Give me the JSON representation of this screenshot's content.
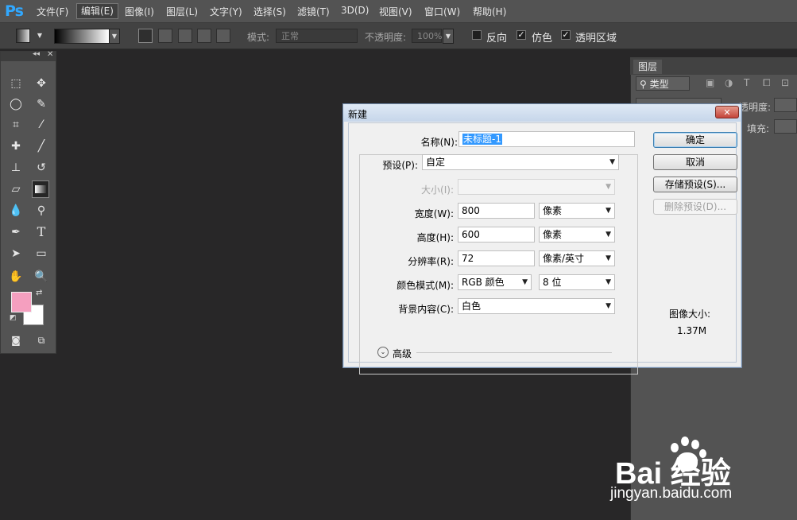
{
  "app": {
    "logo_text": "Ps"
  },
  "menubar": {
    "items": [
      "文件(F)",
      "编辑(E)",
      "图像(I)",
      "图层(L)",
      "文字(Y)",
      "选择(S)",
      "滤镜(T)",
      "3D(D)",
      "视图(V)",
      "窗口(W)",
      "帮助(H)"
    ],
    "active_index": 1
  },
  "options": {
    "mode_label": "模式:",
    "mode_value": "正常",
    "opacity_label": "不透明度:",
    "opacity_value": "100%",
    "reverse_label": "反向",
    "reverse_checked": false,
    "dither_label": "仿色",
    "dither_checked": true,
    "transparency_label": "透明区域",
    "transparency_checked": true
  },
  "tools": {
    "foreground_color": "#f59fbf",
    "background_color": "#ffffff",
    "selected": "gradient-tool"
  },
  "layers_panel": {
    "tab_label": "图层",
    "filter_label": "类型",
    "opacity_label": "透明度:",
    "fill_label": "填充:"
  },
  "dialog": {
    "title": "新建",
    "close_symbol": "✕",
    "name_label": "名称(N):",
    "name_value": "未标题-1",
    "preset_label": "预设(P):",
    "preset_value": "自定",
    "size_label": "大小(I):",
    "size_value": "",
    "width_label": "宽度(W):",
    "width_value": "800",
    "width_unit": "像素",
    "height_label": "高度(H):",
    "height_value": "600",
    "height_unit": "像素",
    "resolution_label": "分辨率(R):",
    "resolution_value": "72",
    "resolution_unit": "像素/英寸",
    "colormode_label": "颜色模式(M):",
    "colormode_value": "RGB 颜色",
    "bitdepth_value": "8 位",
    "background_label": "背景内容(C):",
    "background_value": "白色",
    "advanced_label": "高级",
    "ok_label": "确定",
    "cancel_label": "取消",
    "save_preset_label": "存储预设(S)...",
    "delete_preset_label": "删除预设(D)...",
    "image_size_label": "图像大小:",
    "image_size_value": "1.37M"
  },
  "watermark": {
    "brand": "Bai 经验",
    "url": "jingyan.baidu.com"
  }
}
